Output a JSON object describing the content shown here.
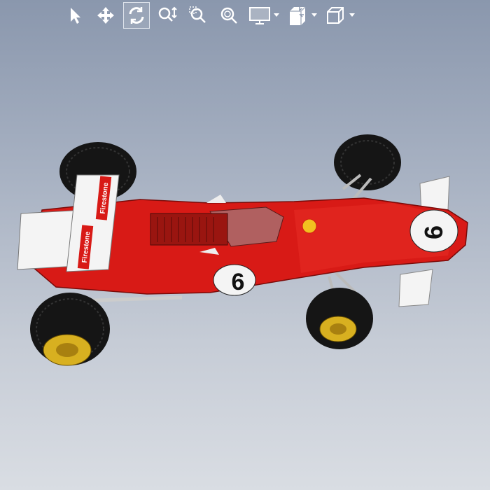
{
  "toolbar": {
    "tools": [
      {
        "id": "select",
        "icon": "cursor-arrow-icon",
        "active": false
      },
      {
        "id": "pan",
        "icon": "move-arrows-icon",
        "active": false
      },
      {
        "id": "rotate",
        "icon": "rotate-icon",
        "active": true
      },
      {
        "id": "zoom-in-out",
        "icon": "zoom-in-out-icon",
        "active": false
      },
      {
        "id": "zoom-to-area",
        "icon": "zoom-to-area-icon",
        "active": false
      },
      {
        "id": "zoom-to-fit",
        "icon": "zoom-to-fit-icon",
        "active": false
      },
      {
        "id": "display-style",
        "icon": "monitor-icon",
        "active": false,
        "dropdown": true
      },
      {
        "id": "section-view",
        "icon": "section-view-icon",
        "active": false,
        "dropdown": true
      },
      {
        "id": "view-orientation",
        "icon": "cube-icon",
        "active": false,
        "dropdown": true
      }
    ]
  },
  "model": {
    "decals": {
      "sponsor": "Firestone",
      "number": "6"
    },
    "colors": {
      "body": "#d81a16",
      "tire": "#151515",
      "rim": "#d8b020",
      "wing": "#f4f4f4"
    }
  }
}
